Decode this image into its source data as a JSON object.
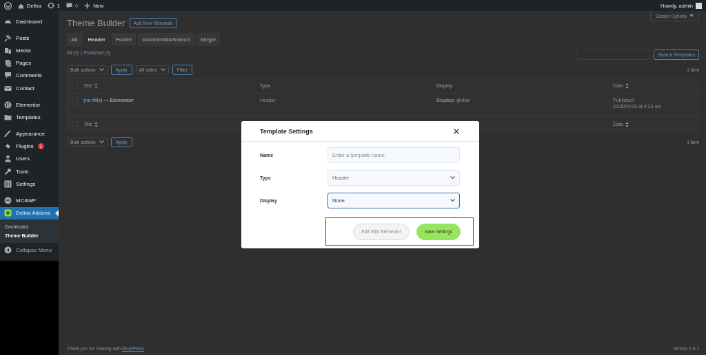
{
  "admin_bar": {
    "site": "Delixa",
    "updates": "1",
    "comments": "0",
    "new": "New",
    "greeting": "Howdy, admin"
  },
  "sidebar": {
    "groups": [
      {
        "items": [
          {
            "label": "Dashboard",
            "selected": false
          }
        ]
      },
      {
        "items": [
          {
            "label": "Posts",
            "selected": false
          },
          {
            "label": "Media",
            "selected": false
          },
          {
            "label": "Pages",
            "selected": false
          },
          {
            "label": "Comments",
            "selected": false
          },
          {
            "label": "Contact",
            "selected": false
          }
        ]
      },
      {
        "items": [
          {
            "label": "Elementor",
            "selected": false
          },
          {
            "label": "Templates",
            "selected": false
          }
        ]
      },
      {
        "items": [
          {
            "label": "Appearance",
            "selected": false
          },
          {
            "label": "Plugins",
            "selected": false,
            "badge": "1"
          },
          {
            "label": "Users",
            "selected": false
          },
          {
            "label": "Tools",
            "selected": false
          },
          {
            "label": "Settings",
            "selected": false
          }
        ]
      },
      {
        "items": [
          {
            "label": "MC4WP",
            "selected": false
          },
          {
            "label": "Delixa Addons",
            "selected": true,
            "children": [
              {
                "label": "Dashboard",
                "selected": false
              },
              {
                "label": "Theme Builder",
                "selected": true
              }
            ]
          }
        ]
      }
    ],
    "collapse": "Collapse Menu"
  },
  "page": {
    "title": "Theme Builder",
    "add_button": "Add New Template",
    "screen_options": "Screen Options",
    "tabs": [
      {
        "label": "All",
        "selected": false
      },
      {
        "label": "Header",
        "selected": true
      },
      {
        "label": "Footer",
        "selected": false
      },
      {
        "label": "Archive/404/Search",
        "selected": false
      },
      {
        "label": "Single",
        "selected": false
      }
    ],
    "views": [
      {
        "label": "All",
        "count": "(3)"
      },
      {
        "label": "Published",
        "count": "(3)"
      }
    ],
    "views_separator": "|",
    "search_button": "Search Templates",
    "bulk_action": "Bulk actions",
    "apply": "Apply",
    "dates": "All dates",
    "filter": "Filter",
    "item_count": "1 item",
    "table": {
      "columns": [
        "Title",
        "Type",
        "Display",
        "Date"
      ],
      "select_all_checked": false,
      "footer_columns": [
        "Title",
        "Date"
      ],
      "footer_select_all_checked": false,
      "rows": [
        {
          "checked": false,
          "title": "(no title)",
          "suffix": "— Elementor",
          "type": "Header",
          "display_label": "Display:",
          "display_value": "global",
          "status": "Published",
          "date": "2025/04/30 at 9:23 am"
        }
      ]
    },
    "bottom_bulk_action": "Bulk actions",
    "bottom_apply": "Apply",
    "bottom_item_count": "1 item",
    "footer": "Thank you for creating with",
    "footer_link": "WordPress",
    "footer_end": ".",
    "version": "Version 6.8.1"
  },
  "modal": {
    "title": "Template Settings",
    "fields": [
      {
        "kind": "text",
        "label": "Name",
        "placeholder": "Enter a template name",
        "focused": false
      },
      {
        "kind": "select",
        "label": "Type",
        "value": "Header",
        "focused": false
      },
      {
        "kind": "select",
        "label": "Display",
        "value": "None",
        "focused": true
      }
    ],
    "buttons": [
      {
        "label": "Edit With Elementor",
        "kind": "secondary",
        "disabled": true
      },
      {
        "label": "Save Settings",
        "kind": "primary",
        "disabled": false
      }
    ],
    "highlighted_actions": true
  }
}
